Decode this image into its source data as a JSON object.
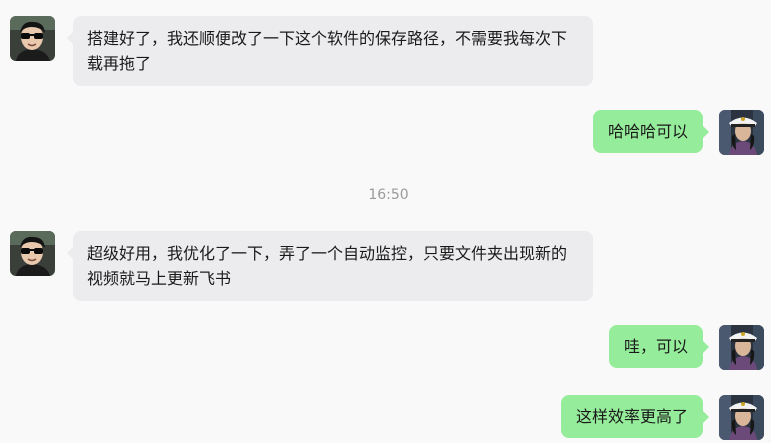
{
  "messages": [
    {
      "side": "left",
      "avatar": "friend-avatar-sunglasses",
      "text": "搭建好了，我还顺便改了一下这个软件的保存路径，不需要我每次下载再拖了"
    },
    {
      "side": "right",
      "avatar": "self-avatar-captain-hat",
      "text": "哈哈哈可以"
    },
    {
      "side": "left",
      "avatar": "friend-avatar-sunglasses",
      "text": "超级好用，我优化了一下，弄了一个自动监控，只要文件夹出现新的视频就马上更新飞书"
    },
    {
      "side": "right",
      "avatar": "self-avatar-captain-hat",
      "text": "哇，可以"
    },
    {
      "side": "right",
      "avatar": "self-avatar-captain-hat",
      "text": "这样效率更高了"
    }
  ],
  "timestamp": "16:50",
  "colors": {
    "background": "#f9f9fa",
    "incoming_bubble": "#ececef",
    "outgoing_bubble": "#95ec9a",
    "timestamp_text": "#9a9a9a"
  }
}
